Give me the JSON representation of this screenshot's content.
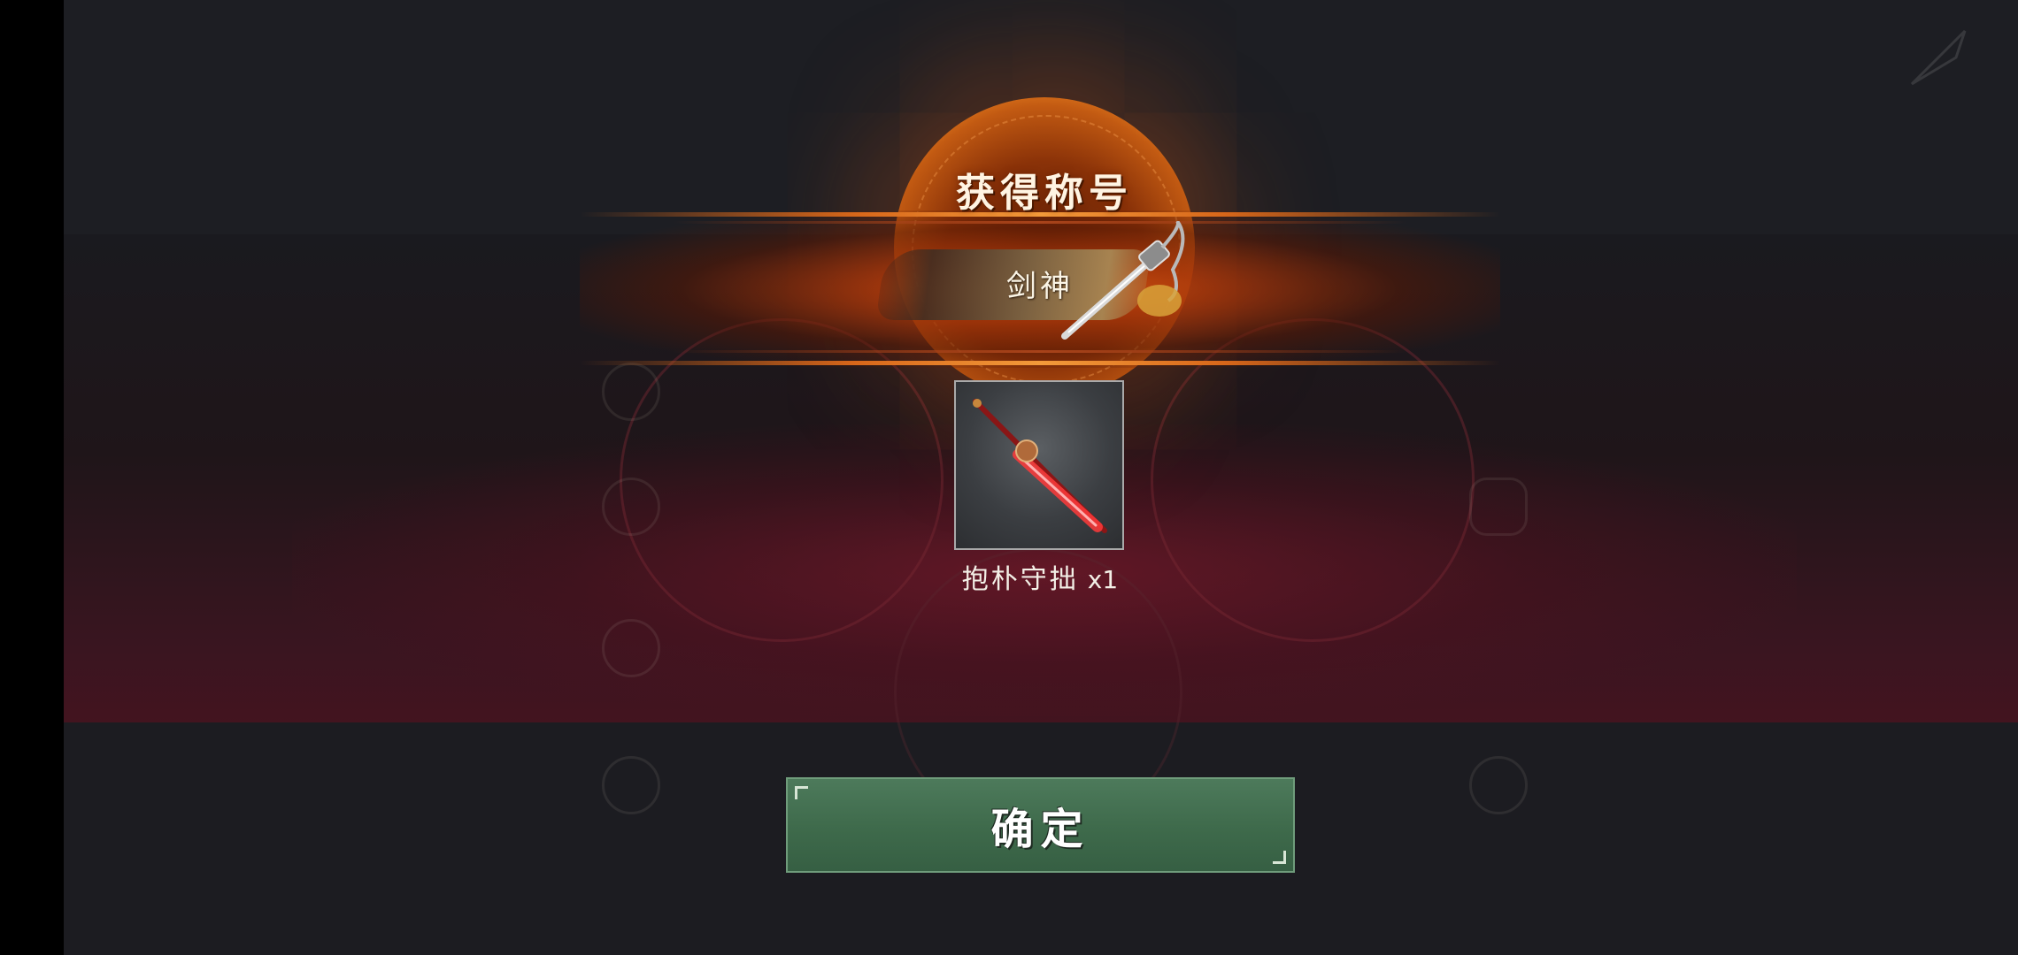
{
  "header": {
    "title": "获得称号"
  },
  "title_banner": {
    "name": "剑神",
    "icon": "sword-icon"
  },
  "reward_item": {
    "name": "抱朴守拙",
    "quantity": "x1",
    "icon": "red-sword-icon"
  },
  "confirm_button": {
    "label": "确定"
  },
  "colors": {
    "accent_orange": "#e27a1e",
    "confirm_green": "#3e6a4b",
    "backdrop_red": "#43141f"
  }
}
